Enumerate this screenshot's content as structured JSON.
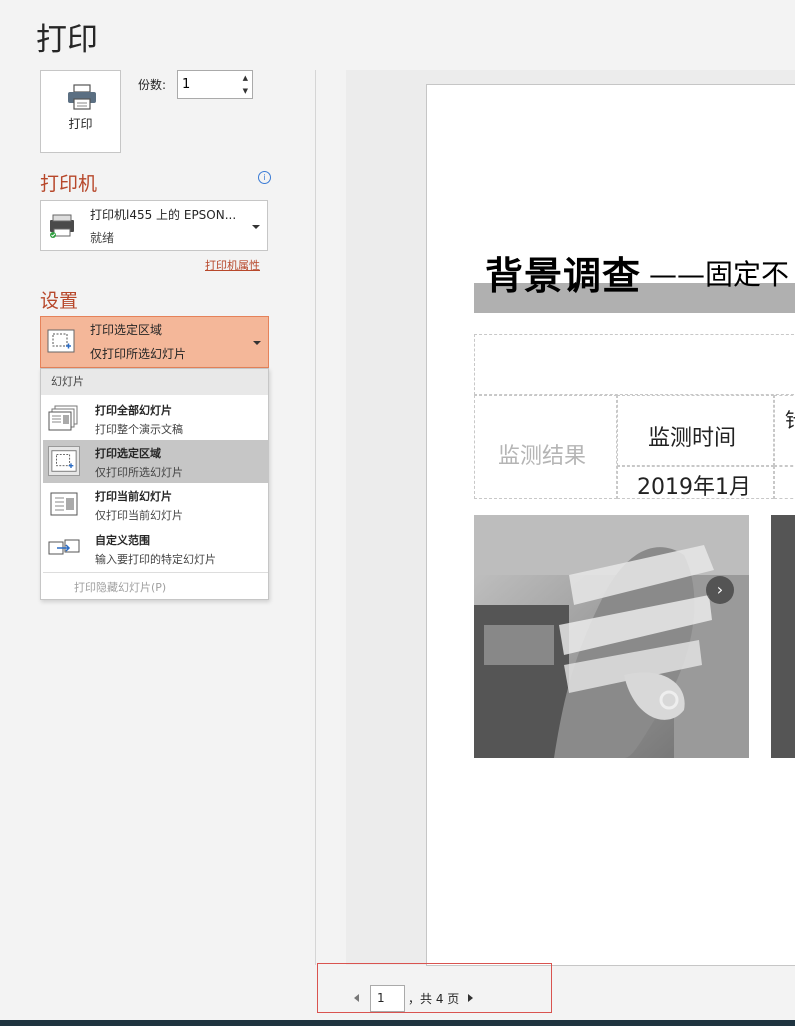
{
  "title": "打印",
  "print_button": {
    "label": "打印",
    "icon": "printer-icon"
  },
  "copies": {
    "label": "份数:",
    "value": "1"
  },
  "printer": {
    "heading": "打印机",
    "name": "打印机l455 上的 EPSON...",
    "status": "就绪",
    "properties_link": "打印机属性"
  },
  "settings": {
    "heading": "设置",
    "selected": {
      "title": "打印选定区域",
      "subtitle": "仅打印所选幻灯片"
    },
    "dropdown": {
      "group_header": "幻灯片",
      "options": [
        {
          "title": "打印全部幻灯片",
          "subtitle": "打印整个演示文稿"
        },
        {
          "title": "打印选定区域",
          "subtitle": "仅打印所选幻灯片"
        },
        {
          "title": "打印当前幻灯片",
          "subtitle": "仅打印当前幻灯片"
        },
        {
          "title": "自定义范围",
          "subtitle": "输入要打印的特定幻灯片"
        }
      ],
      "hidden_slides_option": "打印隐藏幻灯片(P)"
    }
  },
  "preview": {
    "slide_title": "背景调查",
    "slide_title_suffix": "——固定不",
    "table": {
      "result_label": "监测结果",
      "time_header": "监测时间",
      "extra_header": "针",
      "date_value": "2019年1月"
    }
  },
  "navigation": {
    "current_page": "1",
    "total_text": "，共 4 页"
  },
  "colors": {
    "accent": "#b7472a",
    "selected_fill": "#f4b799"
  }
}
